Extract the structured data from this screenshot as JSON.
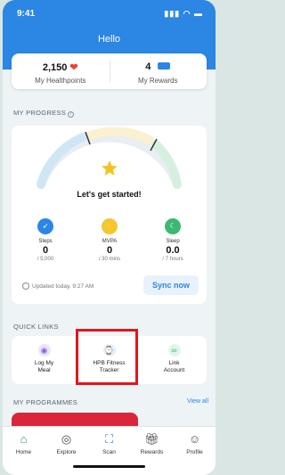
{
  "status_bar": {
    "time": "9:41",
    "icons": "▮▮▮ ◠ ▬"
  },
  "header": {
    "title": "Hello"
  },
  "summary": {
    "healthpoints_value": "2,150",
    "healthpoints_label": "My Healthpoints",
    "rewards_value": "4",
    "rewards_label": "My Rewards"
  },
  "progress": {
    "section_title": "MY PROGRESS",
    "message": "Let's get started!",
    "metrics": [
      {
        "label": "Steps",
        "value": "0",
        "target": "/ 5,000",
        "color": "#2b86e4",
        "icon": "shoe-icon"
      },
      {
        "label": "MVPA",
        "value": "0",
        "target": "/ 30 mins",
        "color": "#f3c733",
        "icon": "bolt-icon"
      },
      {
        "label": "Sleep",
        "value": "0.0",
        "target": "/ 7 hours",
        "color": "#3cb873",
        "icon": "moon-icon"
      }
    ],
    "updated": "Updated today, 9:27 AM",
    "sync_label": "Sync now"
  },
  "quick_links": {
    "section_title": "QUICK LINKS",
    "items": [
      {
        "label_1": "Log My",
        "label_2": "Meal",
        "icon": "meal-icon"
      },
      {
        "label_1": "HPB Fitness",
        "label_2": "Tracker",
        "icon": "watch-icon"
      },
      {
        "label_1": "Link",
        "label_2": "Account",
        "icon": "link-icon"
      }
    ]
  },
  "programmes": {
    "section_title": "MY PROGRAMMES",
    "view_all": "View all"
  },
  "nav": {
    "items": [
      {
        "label": "Home",
        "icon": "home-icon"
      },
      {
        "label": "Explore",
        "icon": "compass-icon"
      },
      {
        "label": "Scan",
        "icon": "scan-icon"
      },
      {
        "label": "Rewards",
        "icon": "gift-icon"
      },
      {
        "label": "Profile",
        "icon": "profile-icon"
      }
    ]
  },
  "colors": {
    "brand_blue": "#2b86e4",
    "highlight_red": "#e0161c"
  }
}
